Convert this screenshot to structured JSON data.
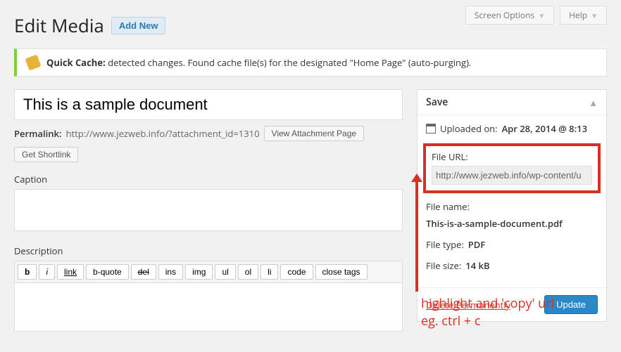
{
  "topbar": {
    "screen_options": "Screen Options",
    "help": "Help"
  },
  "header": {
    "title": "Edit Media",
    "add_new": "Add New"
  },
  "notice": {
    "strong": "Quick Cache:",
    "text": " detected changes. Found cache file(s) for the designated \"Home Page\" (auto-purging)."
  },
  "title_input": "This is a sample document",
  "permalink": {
    "label": "Permalink:",
    "url": "http://www.jezweb.info/?attachment_id=1310",
    "view_btn": "View Attachment Page",
    "shortlink_btn": "Get Shortlink"
  },
  "caption": {
    "label": "Caption",
    "value": ""
  },
  "description": {
    "label": "Description",
    "qt": {
      "b": "b",
      "i": "i",
      "link": "link",
      "bquote": "b-quote",
      "del": "del",
      "ins": "ins",
      "img": "img",
      "ul": "ul",
      "ol": "ol",
      "li": "li",
      "code": "code",
      "close": "close tags"
    },
    "value": ""
  },
  "save": {
    "title": "Save",
    "uploaded_label": "Uploaded on: ",
    "uploaded_value": "Apr 28, 2014 @ 8:13",
    "file_url_label": "File URL:",
    "file_url_value": "http://www.jezweb.info/wp-content/u",
    "file_name_label": "File name: ",
    "file_name_value": "This-is-a-sample-document.pdf",
    "file_type_label": "File type: ",
    "file_type_value": "PDF",
    "file_size_label": "File size: ",
    "file_size_value": "14 kB",
    "delete": "Delete Permanently",
    "update": "Update"
  },
  "annotation": {
    "line1": "highlight and 'copy' url",
    "line2": "eg. ctrl + c"
  }
}
